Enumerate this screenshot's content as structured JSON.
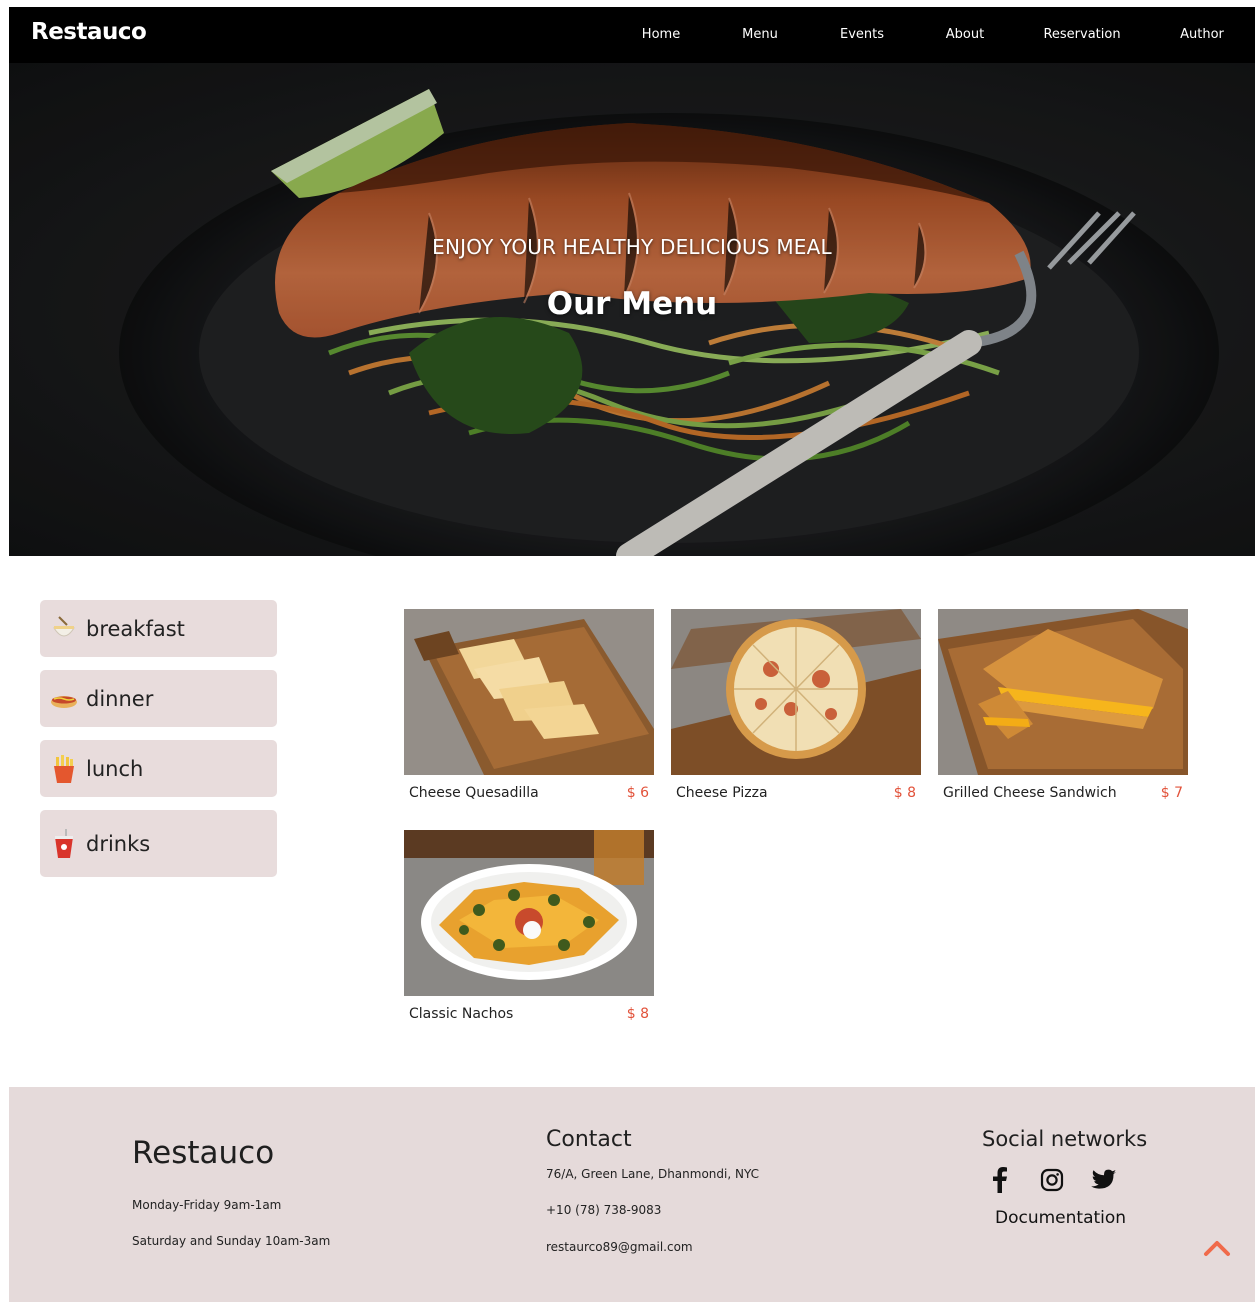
{
  "nav": {
    "brand": "Restauco",
    "links": [
      "Home",
      "Menu",
      "Events",
      "About",
      "Reservation",
      "Author"
    ]
  },
  "hero": {
    "subtitle": "ENJOY YOUR HEALTHY DELICIOUS MEAL",
    "title": "Our Menu"
  },
  "categories": [
    {
      "label": "breakfast",
      "icon": "breakfast-bowl-icon"
    },
    {
      "label": "dinner",
      "icon": "hotdog-icon"
    },
    {
      "label": "lunch",
      "icon": "fries-icon"
    },
    {
      "label": "drinks",
      "icon": "drink-cup-icon"
    }
  ],
  "menu": [
    {
      "name": "Cheese Quesadilla",
      "price": "$ 6"
    },
    {
      "name": "Cheese Pizza",
      "price": "$ 8"
    },
    {
      "name": "Grilled Cheese Sandwich",
      "price": "$ 7"
    },
    {
      "name": "Classic Nachos",
      "price": "$ 8"
    }
  ],
  "footer": {
    "brand": "Restauco",
    "hours": [
      "Monday-Friday 9am-1am",
      "Saturday and Sunday 10am-3am"
    ],
    "contact_title": "Contact",
    "contact": [
      "76/A, Green Lane, Dhanmondi, NYC",
      "+10 (78) 738-9083",
      "restaurco89@gmail.com"
    ],
    "social_title": "Social networks",
    "social_icons": [
      "facebook-icon",
      "instagram-icon",
      "twitter-icon"
    ],
    "documentation": "Documentation"
  },
  "colors": {
    "nav_bg": "#000000",
    "category_bg": "#e8dcdc",
    "footer_bg": "#e5dada",
    "price": "#e2523a",
    "accent": "#f06a4a"
  }
}
